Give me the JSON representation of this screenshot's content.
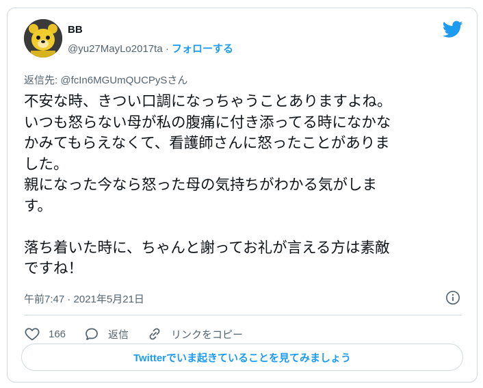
{
  "author": {
    "name": "BB",
    "handle": "@yu27MayLo2017ta",
    "separator": " · ",
    "follow_label": "フォローする"
  },
  "reply": {
    "prefix": "返信先: ",
    "mention": "@fcIn6MGUmQUCPySさん"
  },
  "tweet": {
    "text": "不安な時、きつい口調になっちゃうことありますよね。\nいつも怒らない母が私の腹痛に付き添ってる時になかな\nかみてもらえなくて、看護師さんに怒ったことがありま\nした。\n親になった今なら怒った母の気持ちがわかる気がしま\nす。\n\n落ち着いた時に、ちゃんと謝ってお礼が言える方は素敵\nですね！"
  },
  "meta": {
    "timestamp": "午前7:47 · 2021年5月21日"
  },
  "actions": {
    "like_count": "166",
    "reply_label": "返信",
    "copy_link_label": "リンクをコピー"
  },
  "cta": {
    "label": "Twitterでいま起きていることを見てみましょう"
  },
  "icons": {
    "brand": "twitter-bird-icon",
    "info": "info-icon",
    "like": "heart-icon",
    "reply": "speech-bubble-icon",
    "link": "link-icon"
  },
  "colors": {
    "accent": "#1d9bf0",
    "secondary_text": "#536471",
    "border": "#cfd9de"
  }
}
